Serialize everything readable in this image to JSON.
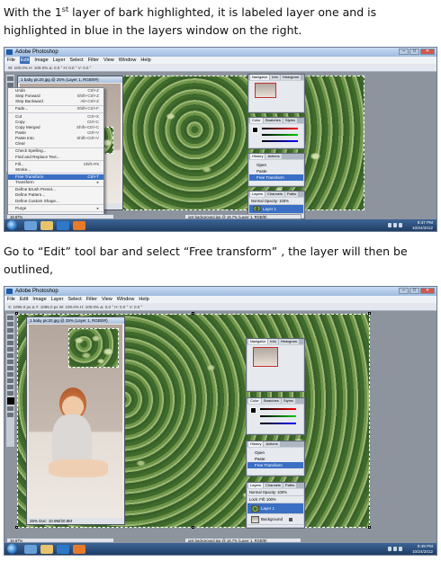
{
  "captions": {
    "caption1_pre": "With the 1",
    "caption1_sup": "st",
    "caption1_post": " layer of bark highlighted, it is labeled layer one and is highlighted in blue in the layers window on the right.",
    "caption2": "Go to “Edit” tool bar and select “Free transform” , the layer will then be outlined,"
  },
  "app": {
    "title": "Adobe Photoshop",
    "menu": [
      "File",
      "Edit",
      "Image",
      "Layer",
      "Select",
      "Filter",
      "View",
      "Window",
      "Help"
    ],
    "active_menu": "Edit"
  },
  "shot1": {
    "options_text": "W: 100.0%   H: 100.0%   Δ: 0.0   °   H: 0.0   °   V: 0.0   °",
    "doc_title": "1 baby pic20.jpg @ 25% (Layer 1, RGB/8#)",
    "zoom": "16.67%",
    "doc_zoom": "25%",
    "doc_status": "Doc: 10.9M/20.8M",
    "edit_menu": [
      {
        "label": "Undo",
        "shortcut": "Ctrl+Z"
      },
      {
        "label": "Step Forward",
        "shortcut": "Shift+Ctrl+Z"
      },
      {
        "label": "Step Backward",
        "shortcut": "Alt+Ctrl+Z"
      },
      {
        "sep": true
      },
      {
        "label": "Fade...",
        "shortcut": "Shift+Ctrl+F"
      },
      {
        "sep": true
      },
      {
        "label": "Cut",
        "shortcut": "Ctrl+X"
      },
      {
        "label": "Copy",
        "shortcut": "Ctrl+C"
      },
      {
        "label": "Copy Merged",
        "shortcut": "Shift+Ctrl+C"
      },
      {
        "label": "Paste",
        "shortcut": "Ctrl+V"
      },
      {
        "label": "Paste Into",
        "shortcut": "Shift+Ctrl+V"
      },
      {
        "label": "Clear",
        "shortcut": ""
      },
      {
        "sep": true
      },
      {
        "label": "Check Spelling...",
        "shortcut": ""
      },
      {
        "label": "Find and Replace Text...",
        "shortcut": ""
      },
      {
        "sep": true
      },
      {
        "label": "Fill...",
        "shortcut": "Shift+F5"
      },
      {
        "label": "Stroke...",
        "shortcut": ""
      },
      {
        "sep": true
      },
      {
        "label": "Free Transform",
        "shortcut": "Ctrl+T",
        "highlight": true
      },
      {
        "label": "Transform",
        "shortcut": "▸"
      },
      {
        "sep": true
      },
      {
        "label": "Define Brush Preset...",
        "shortcut": ""
      },
      {
        "label": "Define Pattern...",
        "shortcut": ""
      },
      {
        "label": "Define Custom Shape...",
        "shortcut": ""
      },
      {
        "sep": true
      },
      {
        "label": "Purge",
        "shortcut": "▸"
      },
      {
        "sep": true
      },
      {
        "label": "Adobe PDF Presets...",
        "shortcut": ""
      },
      {
        "label": "Preset Manager...",
        "shortcut": ""
      },
      {
        "sep": true
      },
      {
        "label": "Color Settings...",
        "shortcut": "Shift+Ctrl+K"
      },
      {
        "label": "Assign Profile...",
        "shortcut": ""
      },
      {
        "label": "Convert to Profile...",
        "shortcut": ""
      },
      {
        "sep": true
      },
      {
        "label": "Keyboard Shortcuts...",
        "shortcut": "Alt+Shift+Ctrl+K"
      },
      {
        "label": "Menus...",
        "shortcut": "Alt+Shift+Ctrl+M"
      },
      {
        "label": "Preferences",
        "shortcut": "▸"
      }
    ],
    "bark_doc": "just background.jpg @ 16.7% (Layer 1, RGB/8)",
    "clock_time": "8:47 PM",
    "clock_date": "10/24/2012"
  },
  "shot2": {
    "options_text": "X: 1095.0 px   Δ Y: 1095.0 px   W: 100.0%   H: 100.0%   Δ: 0.0   °   H: 0.0   °   V: 0.0   °",
    "doc_title": "1 baby pic20.jpg @ 25% (Layer 1, RGB/8#)",
    "zoom": "16.67%",
    "doc_zoom": "25%",
    "doc_status": "Doc: 10.9M/20.8M",
    "bark_doc": "just background.jpg @ 16.7% (Layer 1, RGB/8)",
    "clock_time": "8:49 PM",
    "clock_date": "10/24/2012"
  },
  "panels": {
    "navigator_tabs": [
      "Navigator",
      "Info",
      "Histogram"
    ],
    "color_tabs": [
      "Color",
      "Swatches",
      "Styles"
    ],
    "color_channels": [
      "R",
      "G",
      "B"
    ],
    "color_values": [
      "0",
      "0",
      "0"
    ],
    "history_tabs": [
      "History",
      "Actions"
    ],
    "history_items": [
      "Open",
      "Paste",
      "Free Transform"
    ],
    "layers_tabs": [
      "Layers",
      "Channels",
      "Paths"
    ],
    "blend_mode": "Normal",
    "opacity_label": "Opacity:",
    "opacity_value": "100%",
    "lock_label": "Lock:",
    "fill_label": "Fill:",
    "fill_value": "100%",
    "layers": [
      "Layer 1",
      "Background"
    ],
    "selected_layer": "Layer 1",
    "file_browser": [
      "File Browser",
      "Layer Comps"
    ]
  },
  "colors": {
    "highlight_blue": "#3a6fc4",
    "taskbar": "#1f3e66"
  }
}
